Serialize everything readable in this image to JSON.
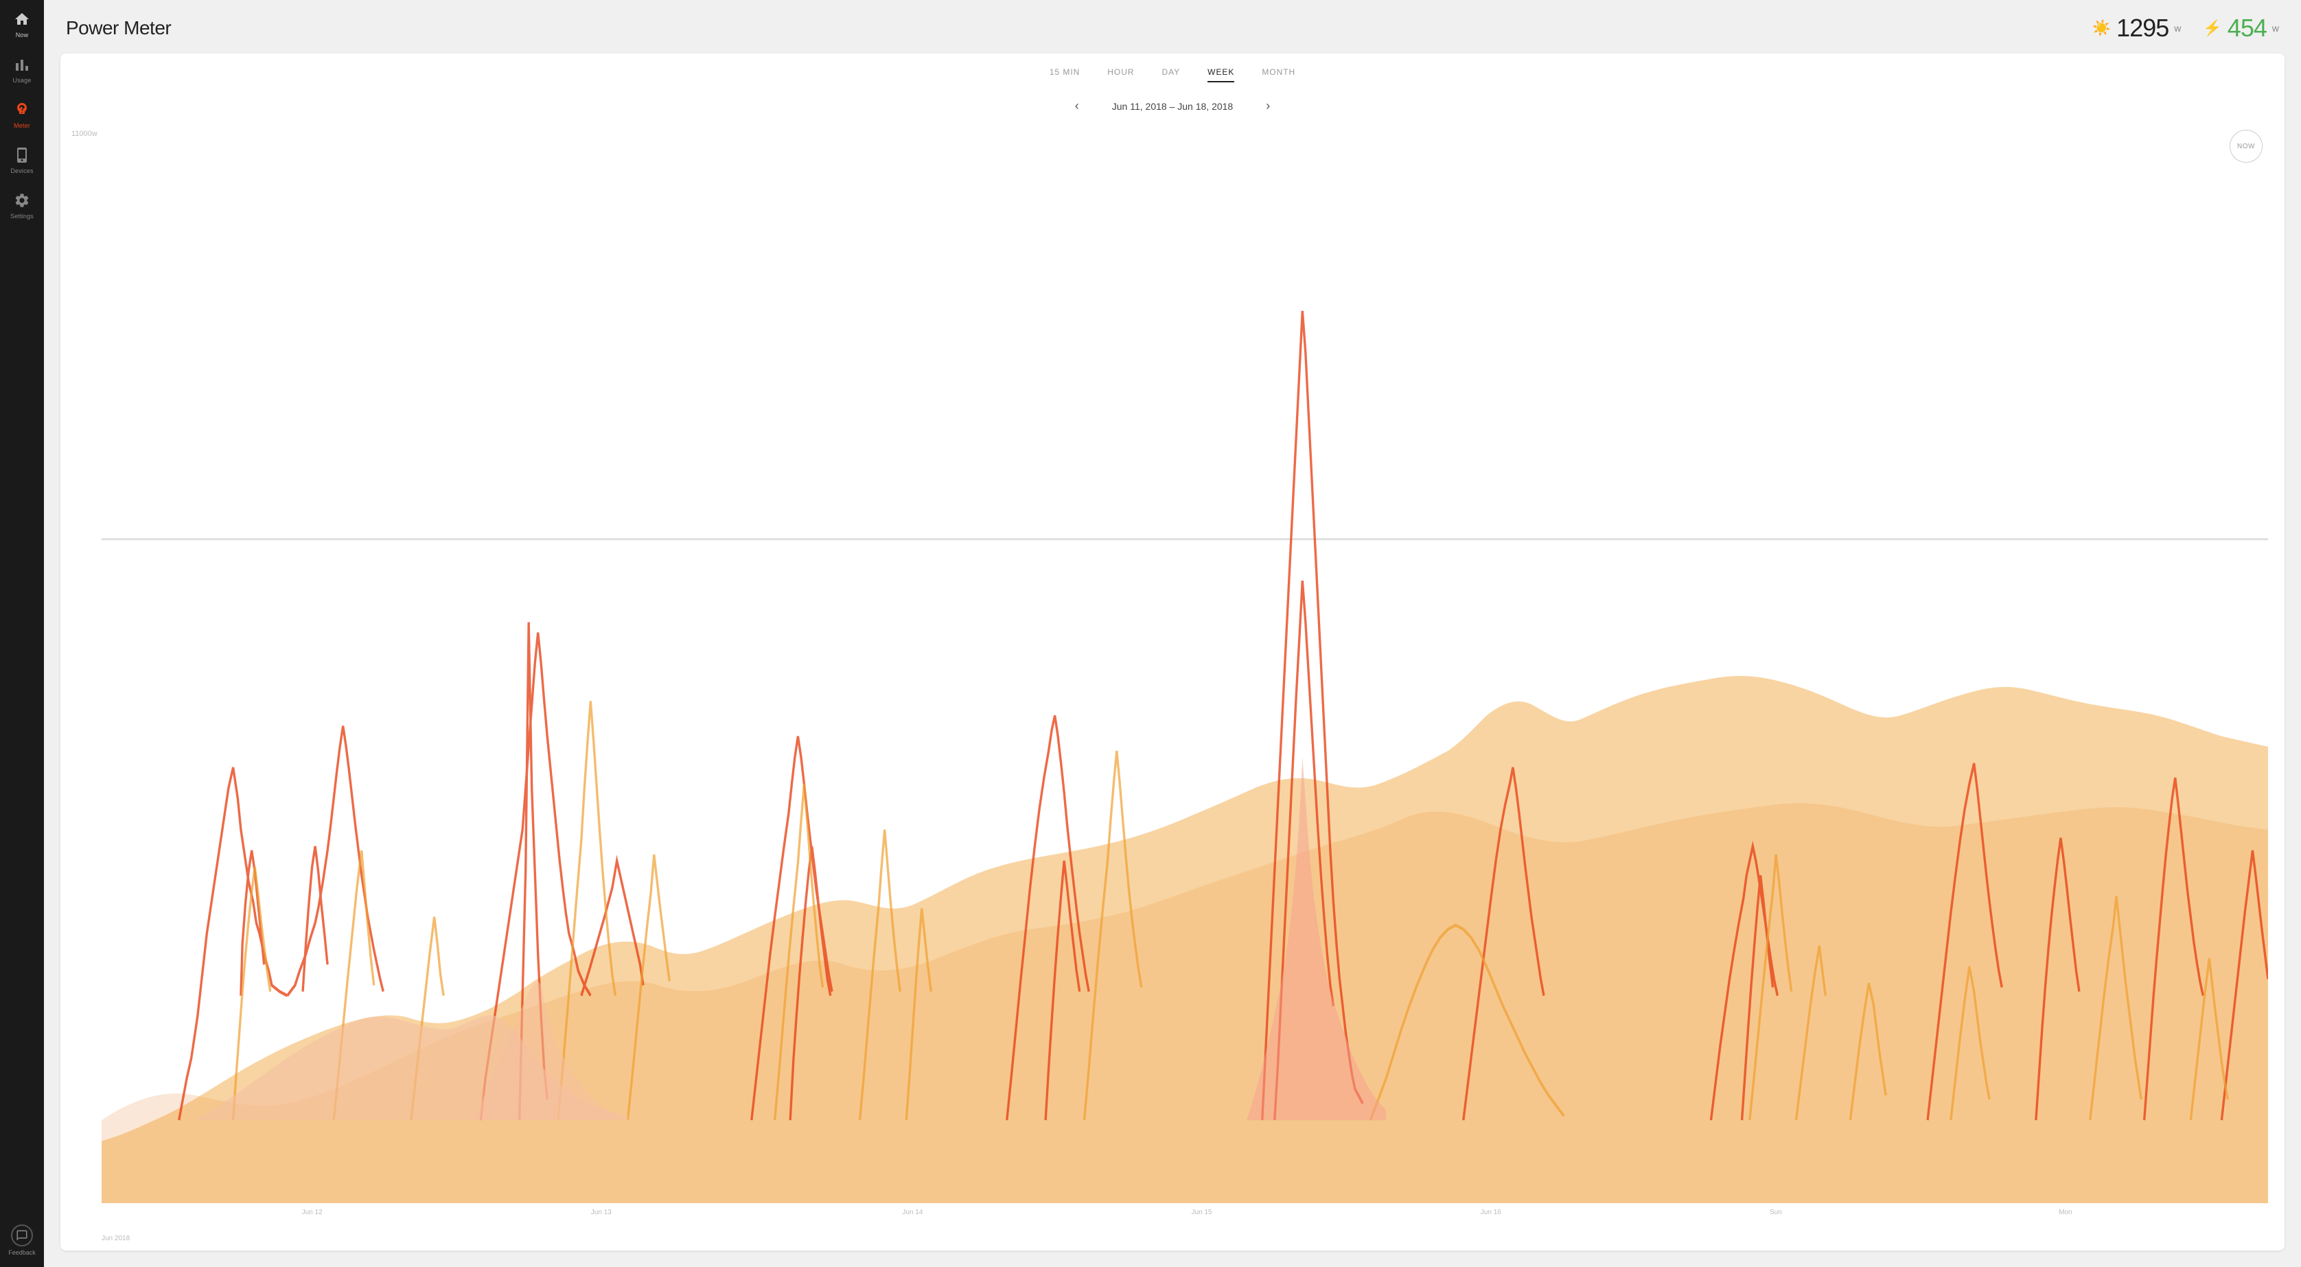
{
  "sidebar": {
    "items": [
      {
        "id": "now",
        "label": "Now",
        "active": false
      },
      {
        "id": "usage",
        "label": "Usage",
        "active": false
      },
      {
        "id": "meter",
        "label": "Meter",
        "active": true
      },
      {
        "id": "devices",
        "label": "Devices",
        "active": false
      },
      {
        "id": "settings",
        "label": "Settings",
        "active": false
      }
    ],
    "feedback_label": "Feedback"
  },
  "header": {
    "title": "Power Meter",
    "solar_value": "1295",
    "solar_unit": "w",
    "grid_value": "454",
    "grid_unit": "w"
  },
  "chart": {
    "time_tabs": [
      {
        "id": "15min",
        "label": "15 MIN",
        "active": false
      },
      {
        "id": "hour",
        "label": "HOUR",
        "active": false
      },
      {
        "id": "day",
        "label": "DAY",
        "active": false
      },
      {
        "id": "week",
        "label": "WEEK",
        "active": true
      },
      {
        "id": "month",
        "label": "MONTH",
        "active": false
      }
    ],
    "date_range": "Jun 11, 2018 – Jun 18, 2018",
    "prev_arrow": "‹",
    "next_arrow": "›",
    "y_label": "11000w",
    "now_button": "NOW",
    "x_labels": [
      {
        "text": "Jun 12",
        "pos_pct": 9
      },
      {
        "text": "Jun 13",
        "pos_pct": 22
      },
      {
        "text": "Jun 14",
        "pos_pct": 36
      },
      {
        "text": "Jun 15",
        "pos_pct": 50
      },
      {
        "text": "Jun 16",
        "pos_pct": 63
      },
      {
        "text": "Sun",
        "pos_pct": 77
      },
      {
        "text": "Mon",
        "pos_pct": 91
      }
    ],
    "month_label": "Jun 2018",
    "colors": {
      "red": "#e8451a",
      "orange": "#f0a030",
      "pink": "#f5c0a0",
      "light_pink": "#f8d8c8"
    }
  }
}
